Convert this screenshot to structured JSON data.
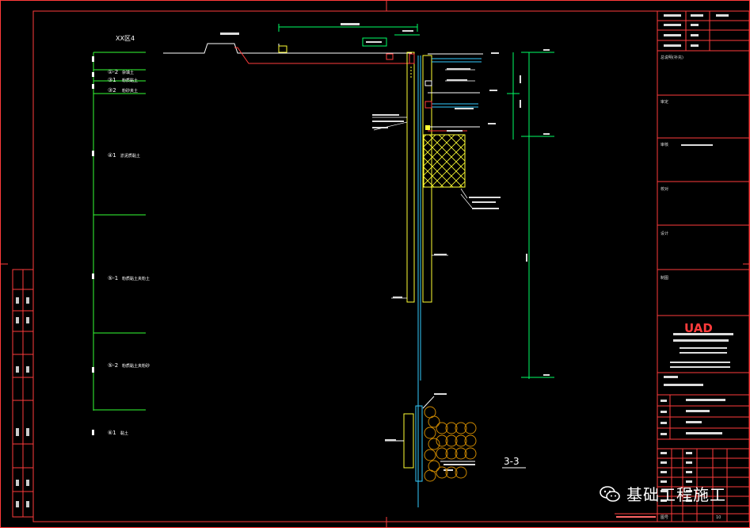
{
  "drawing": {
    "soil_header": "XX区4",
    "soil_layers": [
      {
        "id": "①-2",
        "name": "杂填土"
      },
      {
        "id": "③1",
        "name": "粉质黏土"
      },
      {
        "id": "③2",
        "name": "粉砂夹土"
      },
      {
        "id": "④1",
        "name": "淤泥质黏土"
      },
      {
        "id": "⑤-1",
        "name": "粉质黏土夹粉土"
      },
      {
        "id": "⑤-2",
        "name": "粉质黏土夹粉砂"
      },
      {
        "id": "⑥1",
        "name": "黏土"
      }
    ],
    "section_label": "3-3",
    "logo": "UAD"
  },
  "title_block": {
    "sections": [
      "总说明(补充)",
      "审定",
      "审核",
      "校对",
      "设计",
      "制图"
    ],
    "sheet_label": "图号",
    "sheet_no": "10"
  },
  "watermark": {
    "text": "基础工程施工"
  },
  "colors": {
    "frame": "#ff3b3b",
    "soil": "#33ff33",
    "wall": "#ffff33",
    "pile": "#33ccff",
    "dim": "#00ff66",
    "text": "#ffffff"
  }
}
